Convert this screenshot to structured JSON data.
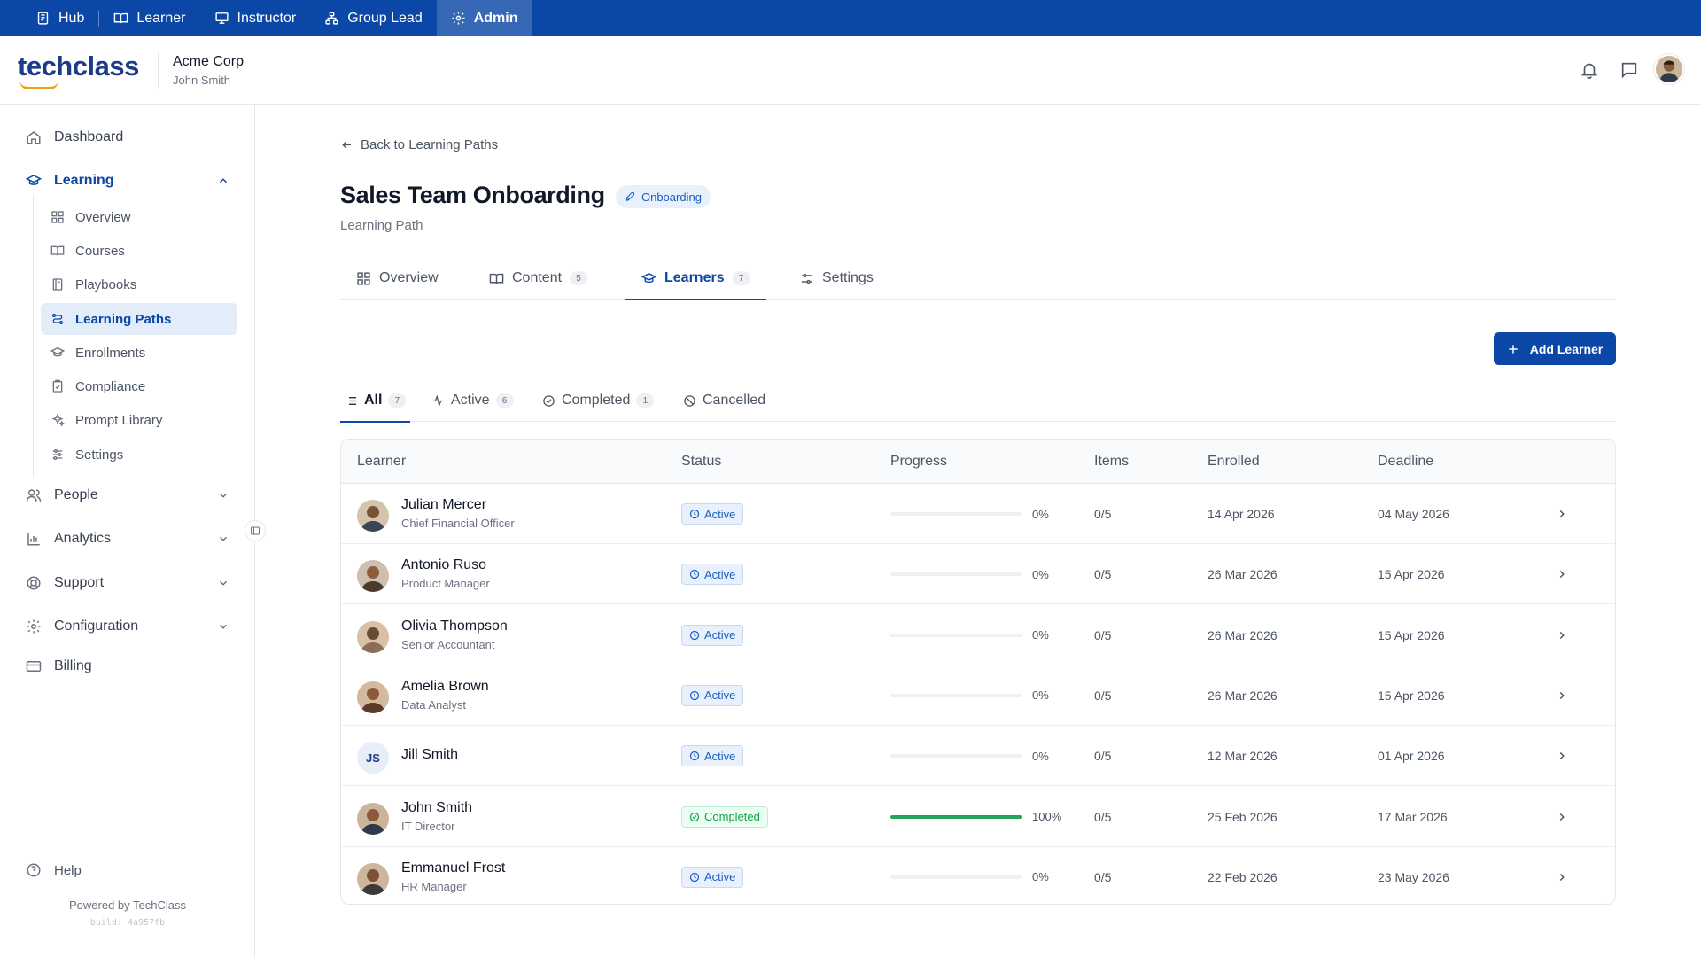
{
  "roles": [
    {
      "label": "Hub",
      "icon": "hub-icon",
      "active": false
    },
    {
      "label": "Learner",
      "icon": "book-icon",
      "active": false
    },
    {
      "label": "Instructor",
      "icon": "presentation-icon",
      "active": false
    },
    {
      "label": "Group Lead",
      "icon": "group-icon",
      "active": false
    },
    {
      "label": "Admin",
      "icon": "gear-icon",
      "active": true
    }
  ],
  "header": {
    "logo": "techclass",
    "org_name": "Acme Corp",
    "user_name": "John Smith"
  },
  "sidebar": {
    "items": [
      {
        "label": "Dashboard",
        "icon": "home-icon"
      },
      {
        "label": "Learning",
        "icon": "graduation-cap-icon",
        "open": true
      },
      {
        "label": "People",
        "icon": "users-icon"
      },
      {
        "label": "Analytics",
        "icon": "bar-chart-icon"
      },
      {
        "label": "Support",
        "icon": "lifebuoy-icon"
      },
      {
        "label": "Configuration",
        "icon": "gear-icon"
      },
      {
        "label": "Billing",
        "icon": "credit-card-icon"
      }
    ],
    "learning_sub": [
      {
        "label": "Overview",
        "icon": "grid-icon"
      },
      {
        "label": "Courses",
        "icon": "book-open-icon"
      },
      {
        "label": "Playbooks",
        "icon": "notebook-icon"
      },
      {
        "label": "Learning Paths",
        "icon": "route-icon",
        "selected": true
      },
      {
        "label": "Enrollments",
        "icon": "graduation-cap-icon"
      },
      {
        "label": "Compliance",
        "icon": "clipboard-check-icon"
      },
      {
        "label": "Prompt Library",
        "icon": "sparkles-icon"
      },
      {
        "label": "Settings",
        "icon": "sliders-icon"
      }
    ],
    "help": "Help",
    "powered_by": "Powered by TechClass",
    "build": "build: 4a957fb"
  },
  "page": {
    "back_label": "Back to Learning Paths",
    "title": "Sales Team Onboarding",
    "badge": "Onboarding",
    "subtitle": "Learning Path",
    "tabs": [
      {
        "label": "Overview",
        "icon": "grid-icon",
        "count": ""
      },
      {
        "label": "Content",
        "icon": "book-open-icon",
        "count": "5"
      },
      {
        "label": "Learners",
        "icon": "graduation-cap-icon",
        "count": "7",
        "active": true
      },
      {
        "label": "Settings",
        "icon": "sliders-icon",
        "count": ""
      }
    ],
    "add_button": "Add Learner",
    "filters": [
      {
        "label": "All",
        "icon": "list-icon",
        "count": "7",
        "active": true
      },
      {
        "label": "Active",
        "icon": "activity-icon",
        "count": "6"
      },
      {
        "label": "Completed",
        "icon": "check-circle-icon",
        "count": "1"
      },
      {
        "label": "Cancelled",
        "icon": "ban-icon",
        "count": ""
      }
    ]
  },
  "table": {
    "columns": [
      "Learner",
      "Status",
      "Progress",
      "Items",
      "Enrolled",
      "Deadline"
    ],
    "rows": [
      {
        "name": "Julian Mercer",
        "role": "Chief Financial Officer",
        "status": "Active",
        "progress_pct": 0,
        "progress": "0%",
        "items": "0/5",
        "enrolled": "14 Apr 2026",
        "deadline": "04 May 2026",
        "avatar": "photo"
      },
      {
        "name": "Antonio Ruso",
        "role": "Product Manager",
        "status": "Active",
        "progress_pct": 0,
        "progress": "0%",
        "items": "0/5",
        "enrolled": "26 Mar 2026",
        "deadline": "15 Apr 2026",
        "avatar": "photo"
      },
      {
        "name": "Olivia Thompson",
        "role": "Senior Accountant",
        "status": "Active",
        "progress_pct": 0,
        "progress": "0%",
        "items": "0/5",
        "enrolled": "26 Mar 2026",
        "deadline": "15 Apr 2026",
        "avatar": "photo"
      },
      {
        "name": "Amelia Brown",
        "role": "Data Analyst",
        "status": "Active",
        "progress_pct": 0,
        "progress": "0%",
        "items": "0/5",
        "enrolled": "26 Mar 2026",
        "deadline": "15 Apr 2026",
        "avatar": "photo"
      },
      {
        "name": "Jill Smith",
        "role": "",
        "status": "Active",
        "progress_pct": 0,
        "progress": "0%",
        "items": "0/5",
        "enrolled": "12 Mar 2026",
        "deadline": "01 Apr 2026",
        "avatar": "JS"
      },
      {
        "name": "John Smith",
        "role": "IT Director",
        "status": "Completed",
        "progress_pct": 100,
        "progress": "100%",
        "items": "0/5",
        "enrolled": "25 Feb 2026",
        "deadline": "17 Mar 2026",
        "avatar": "photo"
      },
      {
        "name": "Emmanuel Frost",
        "role": "HR Manager",
        "status": "Active",
        "progress_pct": 0,
        "progress": "0%",
        "items": "0/5",
        "enrolled": "22 Feb 2026",
        "deadline": "23 May 2026",
        "avatar": "photo"
      }
    ]
  },
  "colors": {
    "brand": "#0a47a6",
    "success": "#22a559",
    "logo_accent": "#f59e0b"
  }
}
